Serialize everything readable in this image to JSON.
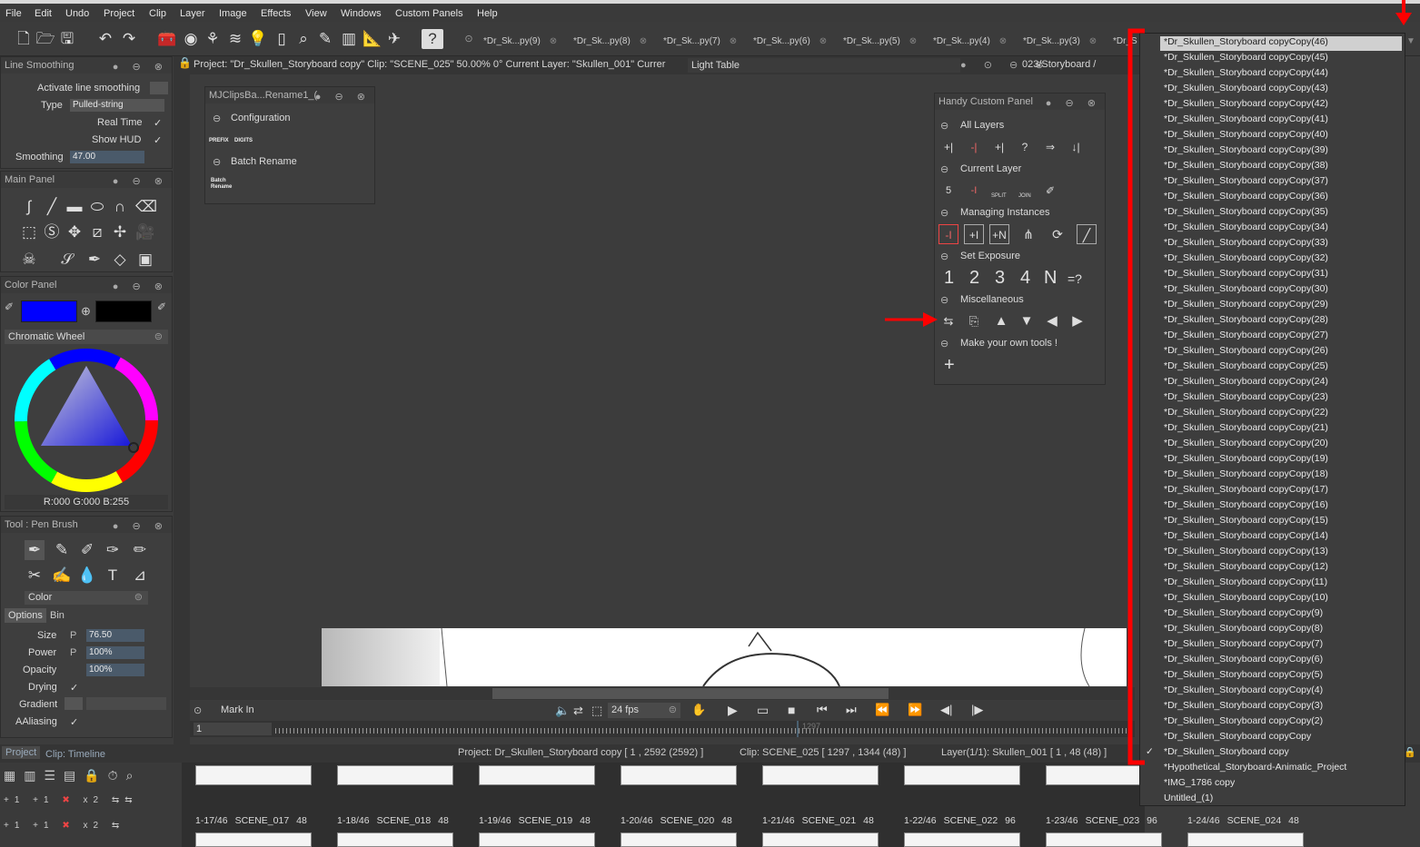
{
  "menubar": {
    "items": [
      "File",
      "Edit",
      "Undo",
      "Project",
      "Clip",
      "Layer",
      "Image",
      "Effects",
      "View",
      "Windows",
      "Custom Panels",
      "Help"
    ]
  },
  "tabs": [
    "*Dr_Sk...py(9)",
    "*Dr_Sk...py(8)",
    "*Dr_Sk...py(7)",
    "*Dr_Sk...py(6)",
    "*Dr_Sk...py(5)",
    "*Dr_Sk...py(4)",
    "*Dr_Sk...py(3)",
    "*Dr_S"
  ],
  "line_smoothing": {
    "title": "Line Smoothing",
    "activate_label": "Activate line smoothing",
    "type_label": "Type",
    "type_value": "Pulled-string",
    "realtime_label": "Real Time",
    "showhud_label": "Show HUD",
    "smoothing_label": "Smoothing",
    "smoothing_value": "47.00"
  },
  "main_panel": {
    "title": "Main Panel"
  },
  "color_panel": {
    "title": "Color Panel",
    "wheel_label": "Chromatic Wheel",
    "rgb": "R:000 G:000 B:255",
    "fg_color": "#0000ff",
    "bg_color": "#000000"
  },
  "tool_panel": {
    "title": "Tool : Pen Brush",
    "color_label": "Color",
    "tab_options": "Options",
    "tab_bin": "Bin",
    "size_label": "Size",
    "size_value": "76.50",
    "power_label": "Power",
    "power_value": "100%",
    "opacity_label": "Opacity",
    "opacity_value": "100%",
    "drying_label": "Drying",
    "gradient_label": "Gradient",
    "aaliasing_label": "AAliasing",
    "p_glyph": "P"
  },
  "status": {
    "project_info": "Project:  \"Dr_Skullen_Storyboard copy\"  Clip: \"SCENE_025\"   50.00%   0°  Current Layer: \"Skullen_001\"  Currer",
    "light_table": "Light Table",
    "path_frag": "023/Storyboard /"
  },
  "mjclips": {
    "title": "MJClipsBa...Rename1_(",
    "config": "Configuration",
    "prefix": "PREFIX",
    "digits": "DIGITS",
    "batch": "Batch Rename",
    "batch_small_1": "Batch",
    "batch_small_2": "Rename"
  },
  "handy": {
    "title": "Handy Custom Panel",
    "all_layers": "All Layers",
    "current_layer": "Current Layer",
    "managing": "Managing Instances",
    "set_exposure": "Set Exposure",
    "misc": "Miscellaneous",
    "make_own": "Make your own tools !",
    "exposure_numbers": [
      "1",
      "2",
      "3",
      "4",
      "N",
      "=?"
    ],
    "split": "SPLIT",
    "join": "JOIN",
    "plus": "+"
  },
  "dropdown": {
    "items": [
      "*Dr_Skullen_Storyboard copyCopy(46)",
      "*Dr_Skullen_Storyboard copyCopy(45)",
      "*Dr_Skullen_Storyboard copyCopy(44)",
      "*Dr_Skullen_Storyboard copyCopy(43)",
      "*Dr_Skullen_Storyboard copyCopy(42)",
      "*Dr_Skullen_Storyboard copyCopy(41)",
      "*Dr_Skullen_Storyboard copyCopy(40)",
      "*Dr_Skullen_Storyboard copyCopy(39)",
      "*Dr_Skullen_Storyboard copyCopy(38)",
      "*Dr_Skullen_Storyboard copyCopy(37)",
      "*Dr_Skullen_Storyboard copyCopy(36)",
      "*Dr_Skullen_Storyboard copyCopy(35)",
      "*Dr_Skullen_Storyboard copyCopy(34)",
      "*Dr_Skullen_Storyboard copyCopy(33)",
      "*Dr_Skullen_Storyboard copyCopy(32)",
      "*Dr_Skullen_Storyboard copyCopy(31)",
      "*Dr_Skullen_Storyboard copyCopy(30)",
      "*Dr_Skullen_Storyboard copyCopy(29)",
      "*Dr_Skullen_Storyboard copyCopy(28)",
      "*Dr_Skullen_Storyboard copyCopy(27)",
      "*Dr_Skullen_Storyboard copyCopy(26)",
      "*Dr_Skullen_Storyboard copyCopy(25)",
      "*Dr_Skullen_Storyboard copyCopy(24)",
      "*Dr_Skullen_Storyboard copyCopy(23)",
      "*Dr_Skullen_Storyboard copyCopy(22)",
      "*Dr_Skullen_Storyboard copyCopy(21)",
      "*Dr_Skullen_Storyboard copyCopy(20)",
      "*Dr_Skullen_Storyboard copyCopy(19)",
      "*Dr_Skullen_Storyboard copyCopy(18)",
      "*Dr_Skullen_Storyboard copyCopy(17)",
      "*Dr_Skullen_Storyboard copyCopy(16)",
      "*Dr_Skullen_Storyboard copyCopy(15)",
      "*Dr_Skullen_Storyboard copyCopy(14)",
      "*Dr_Skullen_Storyboard copyCopy(13)",
      "*Dr_Skullen_Storyboard copyCopy(12)",
      "*Dr_Skullen_Storyboard copyCopy(11)",
      "*Dr_Skullen_Storyboard copyCopy(10)",
      "*Dr_Skullen_Storyboard copyCopy(9)",
      "*Dr_Skullen_Storyboard copyCopy(8)",
      "*Dr_Skullen_Storyboard copyCopy(7)",
      "*Dr_Skullen_Storyboard copyCopy(6)",
      "*Dr_Skullen_Storyboard copyCopy(5)",
      "*Dr_Skullen_Storyboard copyCopy(4)",
      "*Dr_Skullen_Storyboard copyCopy(3)",
      "*Dr_Skullen_Storyboard copyCopy(2)",
      "*Dr_Skullen_Storyboard copyCopy",
      "*Dr_Skullen_Storyboard copy",
      "*Hypothetical_Storyboard-Animatic_Project",
      "*IMG_1786 copy",
      "Untitled_(1)"
    ],
    "checked_index": 46
  },
  "timeline": {
    "mark_in": "Mark In",
    "fps": "24 fps",
    "frame": "1",
    "frame_marker": "1297"
  },
  "bottom": {
    "tab_project": "Project",
    "tab_clip": "Clip: Timeline",
    "project_info": "Project: Dr_Skullen_Storyboard copy [ 1 ,  2592  (2592) ]",
    "clip_info": "Clip: SCENE_025 [ 1297 , 1344  (48) ]",
    "layer_info": "Layer(1/1): Skullen_001 [ 1 , 48  (48) ]"
  },
  "scenes": [
    {
      "num": "1-17/46",
      "name": "SCENE_017",
      "len": "48"
    },
    {
      "num": "1-18/46",
      "name": "SCENE_018",
      "len": "48"
    },
    {
      "num": "1-19/46",
      "name": "SCENE_019",
      "len": "48"
    },
    {
      "num": "1-20/46",
      "name": "SCENE_020",
      "len": "48"
    },
    {
      "num": "1-21/46",
      "name": "SCENE_021",
      "len": "48"
    },
    {
      "num": "1-22/46",
      "name": "SCENE_022",
      "len": "96"
    },
    {
      "num": "1-23/46",
      "name": "SCENE_023",
      "len": "96"
    },
    {
      "num": "1-24/46",
      "name": "SCENE_024",
      "len": "48"
    }
  ],
  "colors": {
    "annotation_red": "#ff0000"
  }
}
